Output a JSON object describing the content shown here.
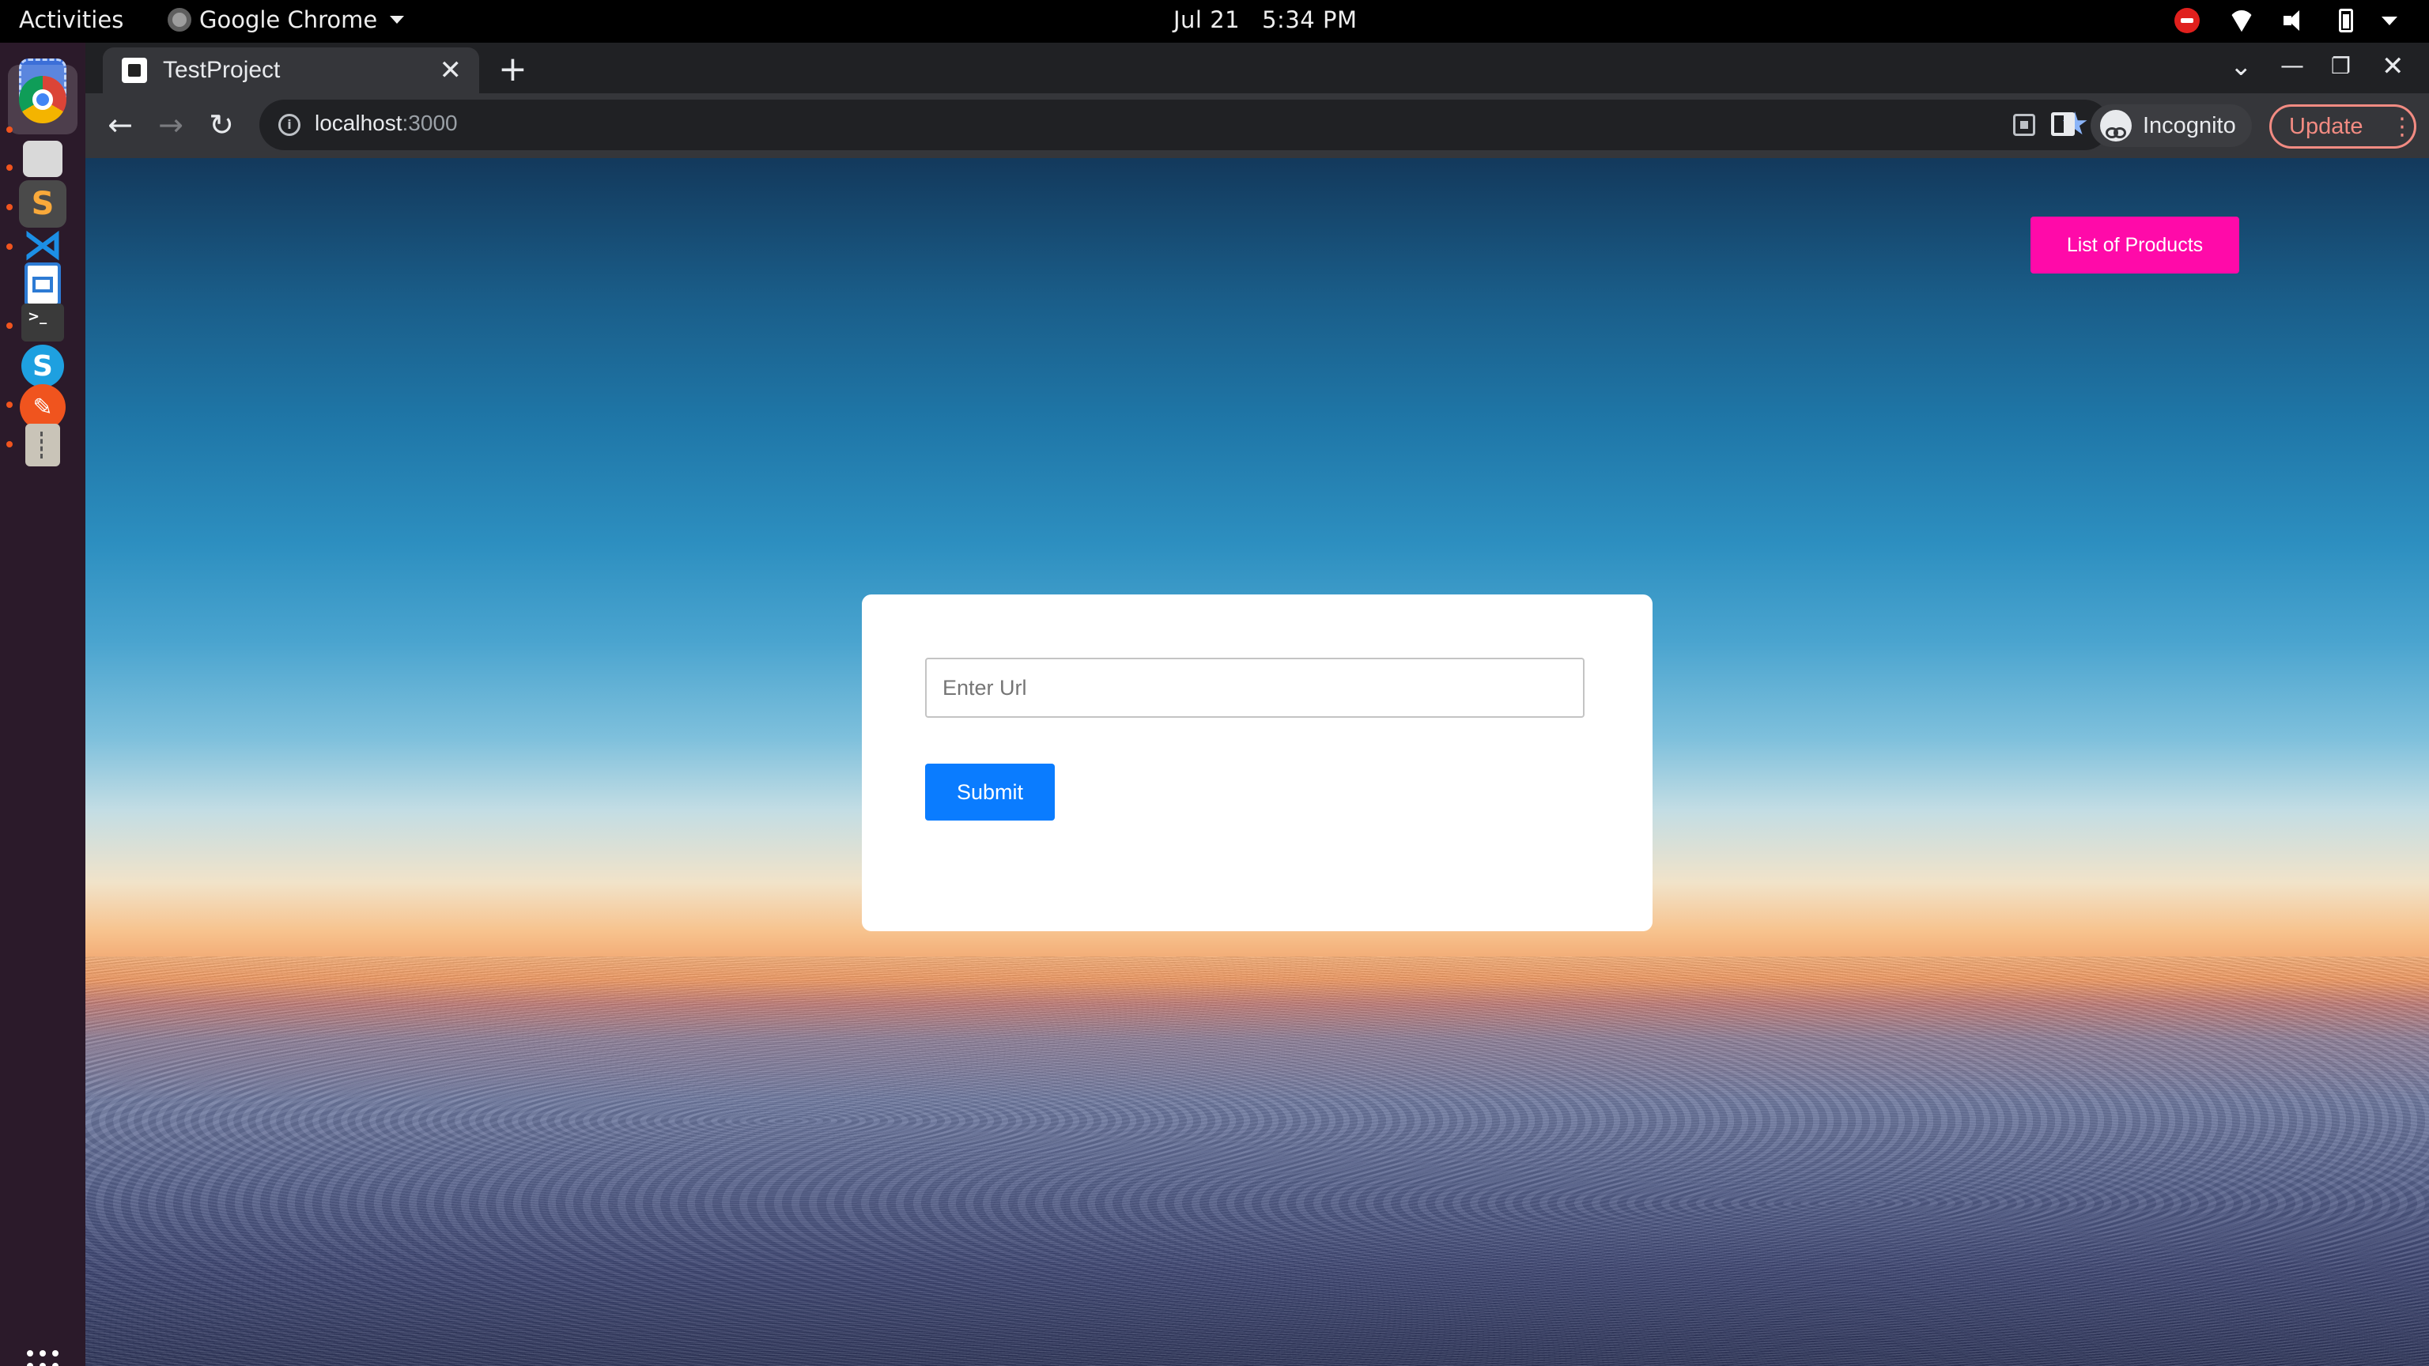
{
  "system_bar": {
    "activities": "Activities",
    "app_name": "Google Chrome",
    "date": "Jul 21",
    "time": "5:34 PM"
  },
  "dock": {
    "items": [
      {
        "name": "screenshot-tool",
        "color": "#3c6fd8"
      },
      {
        "name": "google-chrome",
        "color": "#ffffff",
        "active": true
      },
      {
        "name": "files",
        "color": "#d9d9d9"
      },
      {
        "name": "sublime-text",
        "color": "#f9a93a"
      },
      {
        "name": "vscode",
        "color": "#1c8fe6"
      },
      {
        "name": "libreoffice-writer",
        "color": "#2d7bd4"
      },
      {
        "name": "terminal",
        "color": "#3a3a3a"
      },
      {
        "name": "skype",
        "color": "#1ea0e0"
      },
      {
        "name": "text-editor",
        "color": "#f0541e"
      },
      {
        "name": "archive-manager",
        "color": "#c9c4b8"
      }
    ]
  },
  "browser": {
    "tab_title": "TestProject",
    "url_host": "localhost",
    "url_port": ":3000",
    "profile_label": "Incognito",
    "update_label": "Update"
  },
  "page": {
    "products_button": "List of Products",
    "url_input_placeholder": "Enter Url",
    "url_input_value": "",
    "submit_button": "Submit"
  },
  "colors": {
    "products_button": "#ff0aa9",
    "submit_button": "#0a7cff",
    "update_accent": "#f28b82"
  }
}
